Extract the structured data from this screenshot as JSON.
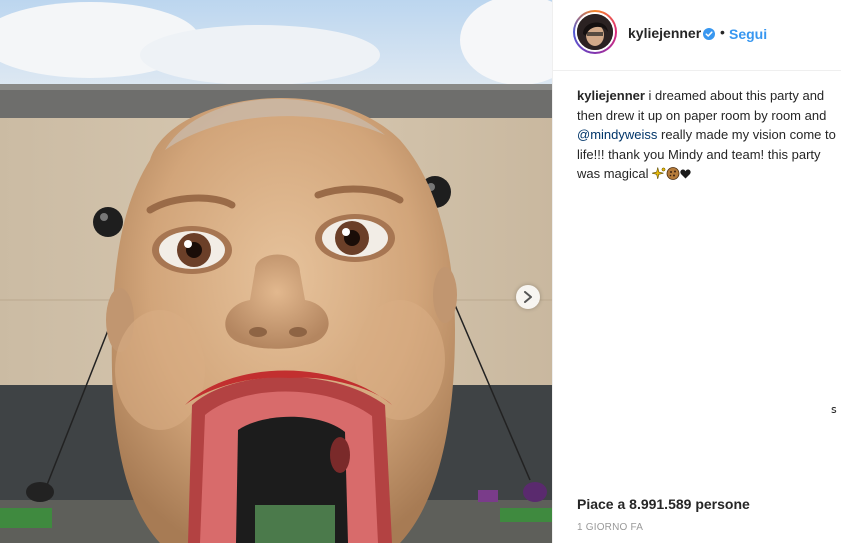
{
  "post": {
    "image_alt": "giant inflatable baby head entrance",
    "next_icon": "chevron-right-icon"
  },
  "header": {
    "username": "kyliejenner",
    "verified_icon": "verified-badge-icon",
    "separator": "•",
    "follow_label": "Segui"
  },
  "caption": {
    "username": "kyliejenner",
    "text_before": " i dreamed about this party and then drew it up on paper room by room and ",
    "mention": "@mindyweiss",
    "text_after": " really made my vision come to life!!! thank you Mindy and team! this party was magical ",
    "emojis": [
      "sparkles-emoji",
      "cookie-emoji",
      "heart-emoji"
    ]
  },
  "stray_char": "ꜱ",
  "likes_text": "Piace a 8.991.589 persone",
  "timestamp": "1 GIORNO FA",
  "colors": {
    "accent": "#3897f0",
    "mention": "#003569",
    "text": "#262626",
    "muted": "#999999"
  }
}
